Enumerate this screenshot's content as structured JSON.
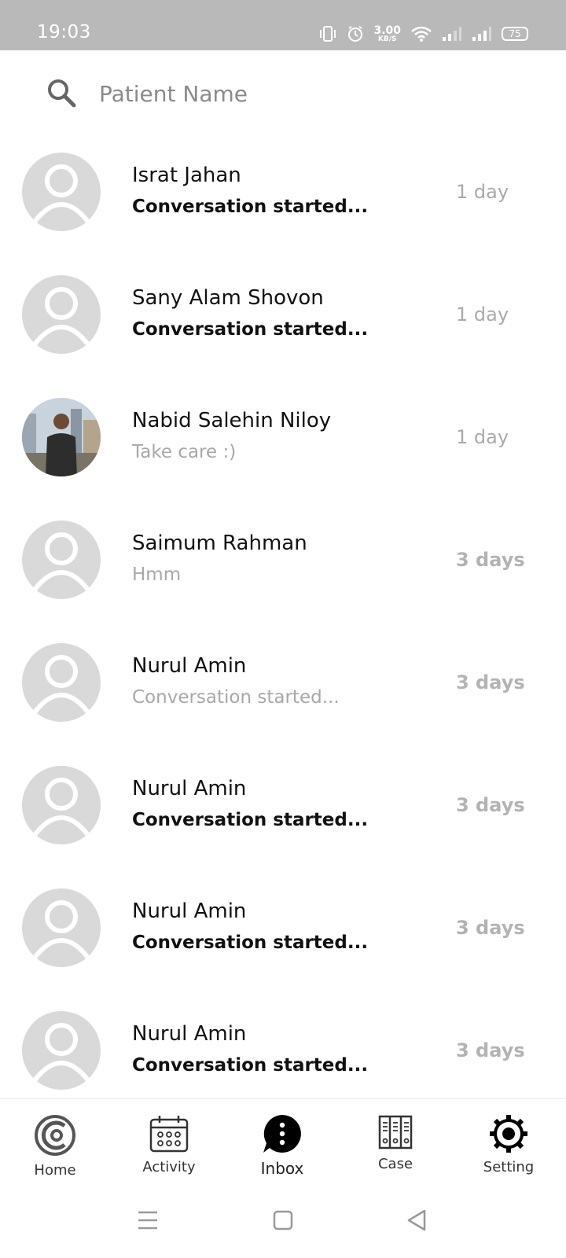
{
  "status_bar": {
    "time": "19:03",
    "net_speed_value": "3.00",
    "net_speed_unit": "KB/S",
    "battery": "75"
  },
  "search": {
    "placeholder": "Patient Name",
    "value": ""
  },
  "conversations": [
    {
      "name": "Israt Jahan",
      "preview": "Conversation started...",
      "time": "1 day",
      "unread": true,
      "photo": false
    },
    {
      "name": "Sany Alam Shovon",
      "preview": "Conversation started...",
      "time": "1 day",
      "unread": true,
      "photo": false
    },
    {
      "name": "Nabid Salehin Niloy",
      "preview": "Take care :)",
      "time": "1 day",
      "unread": false,
      "photo": true
    },
    {
      "name": "Saimum Rahman",
      "preview": "Hmm",
      "time": "3 days",
      "unread": false,
      "photo": false
    },
    {
      "name": "Nurul Amin",
      "preview": "Conversation started...",
      "time": "3 days",
      "unread": false,
      "photo": false
    },
    {
      "name": "Nurul Amin",
      "preview": "Conversation started...",
      "time": "3 days",
      "unread": true,
      "photo": false
    },
    {
      "name": "Nurul Amin",
      "preview": "Conversation started...",
      "time": "3 days",
      "unread": true,
      "photo": false
    },
    {
      "name": "Nurul Amin",
      "preview": "Conversation started...",
      "time": "3 days",
      "unread": true,
      "photo": false
    }
  ],
  "bottom_nav": {
    "home": "Home",
    "activity": "Activity",
    "inbox": "Inbox",
    "case": "Case",
    "setting": "Setting",
    "active": "inbox"
  },
  "colors": {
    "status_bar_bg": "#b9b9b9",
    "avatar_bg": "#d9d9d9",
    "muted_text": "#a8a8a8"
  }
}
